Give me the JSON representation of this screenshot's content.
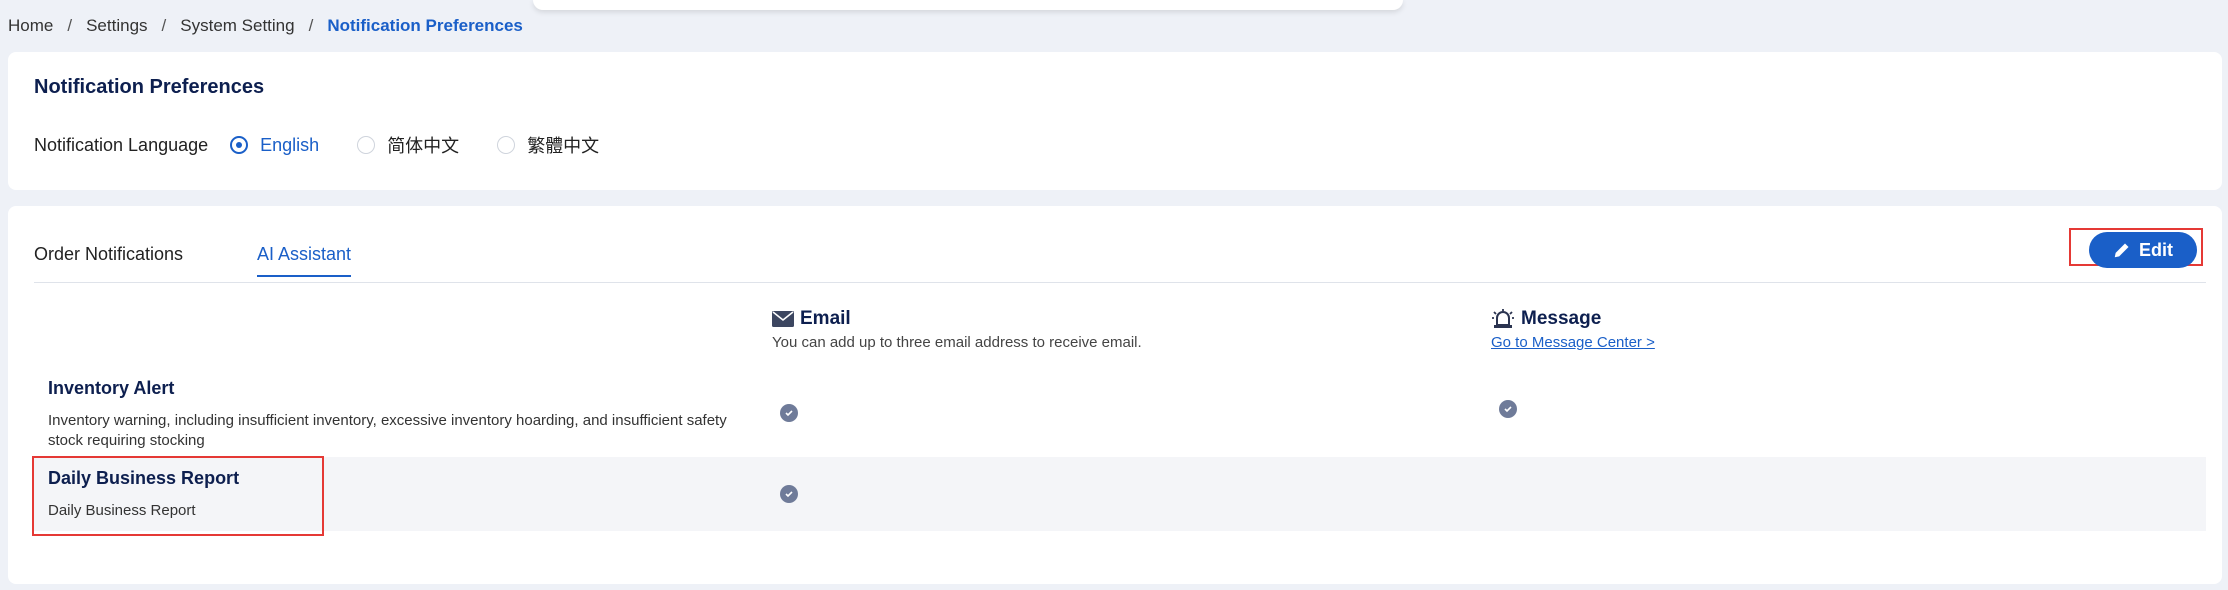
{
  "breadcrumb": {
    "items": [
      "Home",
      "Settings",
      "System Setting"
    ],
    "current": "Notification Preferences",
    "separator": "/"
  },
  "preferences": {
    "title": "Notification Preferences",
    "language_label": "Notification Language",
    "languages": [
      {
        "label": "English",
        "selected": true
      },
      {
        "label": "简体中文",
        "selected": false
      },
      {
        "label": "繁體中文",
        "selected": false
      }
    ]
  },
  "tabs": {
    "items": [
      "Order Notifications",
      "AI Assistant"
    ],
    "active": "AI Assistant"
  },
  "toolbar": {
    "edit_label": "Edit"
  },
  "columns": {
    "email": {
      "title": "Email",
      "icon": "envelope-icon",
      "subtitle": "You can add up to three email address to receive email."
    },
    "message": {
      "title": "Message",
      "icon": "bell-alert-icon",
      "link": "Go to Message Center >"
    }
  },
  "rows": [
    {
      "title": "Inventory Alert",
      "description": "Inventory warning, including insufficient inventory, excessive inventory hoarding, and insufficient safety stock requiring stocking",
      "email": true,
      "message": true
    },
    {
      "title": "Daily Business Report",
      "description": "Daily Business Report",
      "email": true,
      "message": false
    }
  ],
  "colors": {
    "accent": "#1a5fc8",
    "highlight": "#e53935",
    "check": "#6f7b99",
    "title": "#0d1f4f"
  }
}
